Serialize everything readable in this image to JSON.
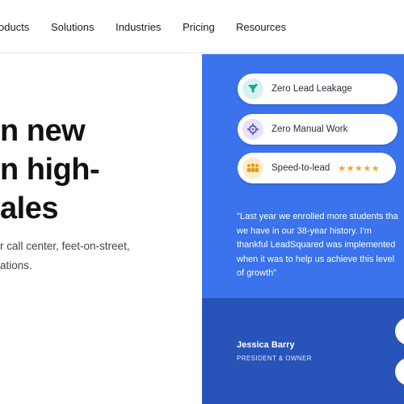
{
  "nav": {
    "items": [
      "oducts",
      "Solutions",
      "Industries",
      "Pricing",
      "Resources"
    ]
  },
  "hero": {
    "title_lines": [
      "n new",
      "n high-",
      "ales"
    ],
    "subtitle_lines": [
      "r call center, feet-on-street,",
      "ations."
    ]
  },
  "features": [
    {
      "label": "Zero Lead Leakage",
      "icon": "funnel-icon"
    },
    {
      "label": "Zero Manual Work",
      "icon": "gear-icon"
    },
    {
      "label": "Speed-to-lead",
      "icon": "team-icon",
      "stars": "★★★★★"
    }
  ],
  "testimonial": {
    "quote_lines": [
      "\"Last year we enrolled more students tha",
      "we have in our 38-year history. I'm",
      "thankful LeadSquared was implemented",
      "when it was to help us achieve this level",
      "of growth\""
    ],
    "name": "Jessica Barry",
    "title": "PRESIDENT & OWNER"
  },
  "colors": {
    "panel_blue": "#3a73ec",
    "panel_dark": "#2853b9",
    "star": "#f5a623"
  }
}
